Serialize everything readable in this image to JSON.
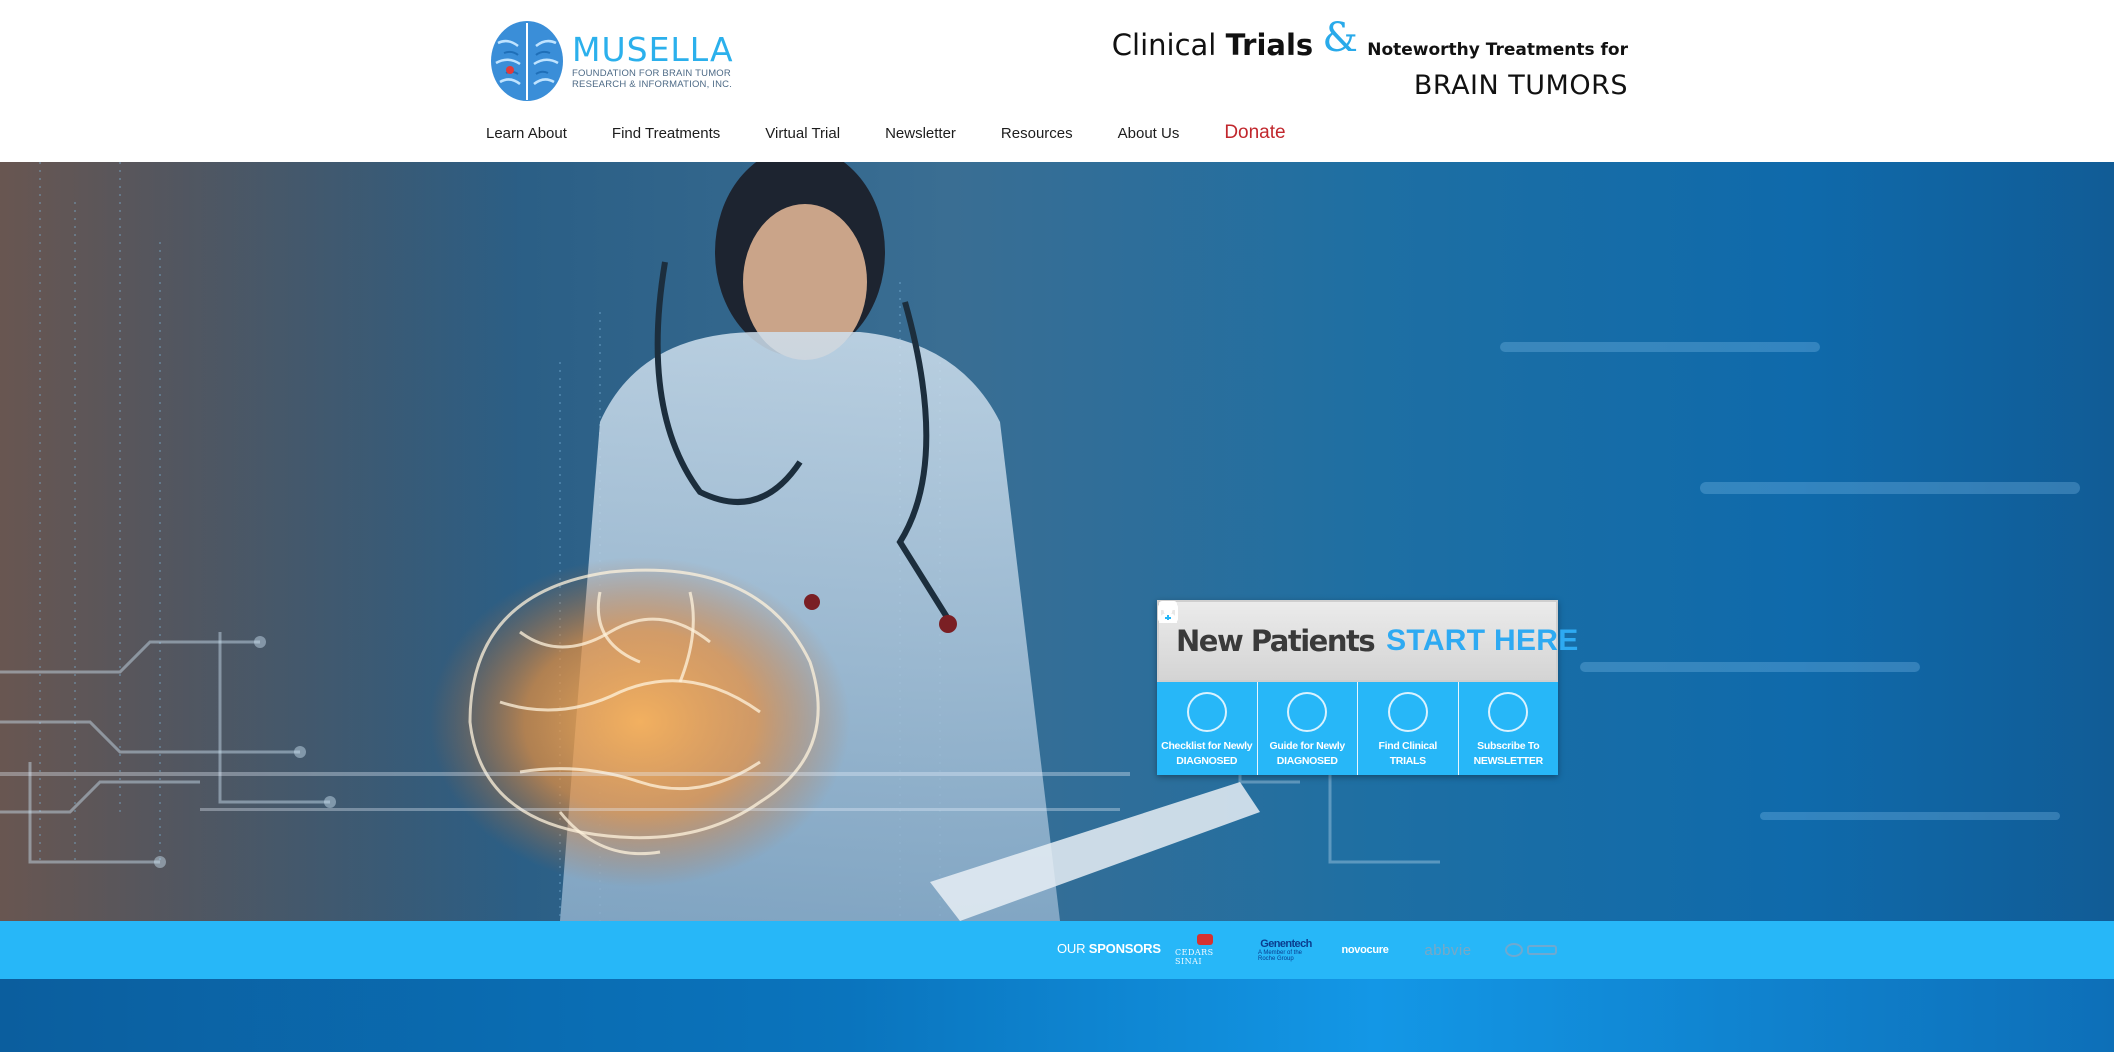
{
  "brand": {
    "name": "MUSELLA",
    "subtitle_line1": "FOUNDATION FOR BRAIN TUMOR",
    "subtitle_line2": "RESEARCH & INFORMATION, INC.",
    "accent_color": "#2bb0ec"
  },
  "tagline": {
    "word1": "Clinical",
    "word2": "Trials",
    "amp": "&",
    "word3": "Noteworthy Treatments for",
    "line2": "BRAIN TUMORS"
  },
  "nav": {
    "items": [
      "Learn About",
      "Find Treatments",
      "Virtual Trial",
      "Newsletter",
      "Resources",
      "About Us"
    ],
    "donate": "Donate",
    "donate_color": "#c1272d"
  },
  "new_patients": {
    "title": "New Patients",
    "cta": "START HERE",
    "tiles": [
      {
        "icon": "checklist-icon",
        "line1": "Checklist for Newly",
        "line2": "DIAGNOSED"
      },
      {
        "icon": "guide-icon",
        "line1": "Guide for Newly",
        "line2": "DIAGNOSED"
      },
      {
        "icon": "doctor-icon",
        "line1": "Find Clinical",
        "line2": "TRIALS"
      },
      {
        "icon": "calendar-icon",
        "line1": "Subscribe To",
        "line2": "NEWSLETTER"
      }
    ]
  },
  "sponsors": {
    "label_light": "OUR",
    "label_bold": "SPONSORS",
    "logos": {
      "cedars": "CEDARS SINAI",
      "genentech": "Genentech",
      "genentech_sub": "A Member of the Roche Group",
      "novocure": "novocure",
      "abbvie": "abbvie"
    },
    "bar_color": "#27b7f8"
  }
}
